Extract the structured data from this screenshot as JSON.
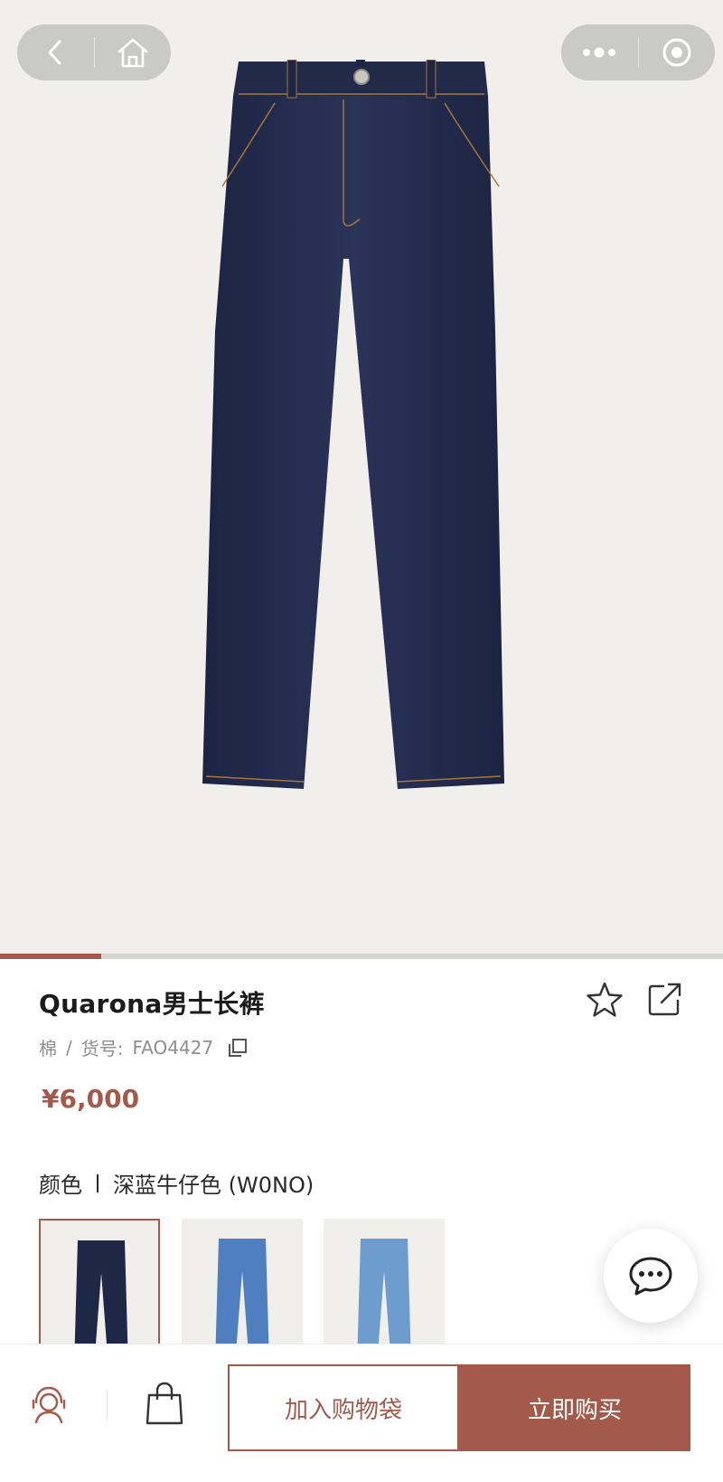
{
  "product": {
    "title": "Quarona男士长裤",
    "material": "棉",
    "sku_separator": "/",
    "sku_label": "货号:",
    "sku": "FAO4427",
    "price": "¥6,000"
  },
  "color": {
    "label": "颜色",
    "selected": "深蓝牛仔色 (W0NO)",
    "swatches": [
      {
        "name": "深蓝牛仔色",
        "hex": "#1f2747"
      },
      {
        "name": "蓝色",
        "hex": "#4f7fc0"
      },
      {
        "name": "浅蓝色",
        "hex": "#6e9ccf"
      }
    ]
  },
  "gallery": {
    "progress": 0.14
  },
  "actions": {
    "add_to_bag": "加入购物袋",
    "buy_now": "立即购买"
  },
  "colors": {
    "accent": "#a45a4a",
    "hero_bg": "#f0efec",
    "denim": "#232b4d"
  },
  "icons": [
    "back-icon",
    "home-icon",
    "more-icon",
    "target-icon",
    "star-icon",
    "share-icon",
    "copy-icon",
    "chat-icon",
    "customer-service-icon",
    "shopping-bag-icon"
  ]
}
